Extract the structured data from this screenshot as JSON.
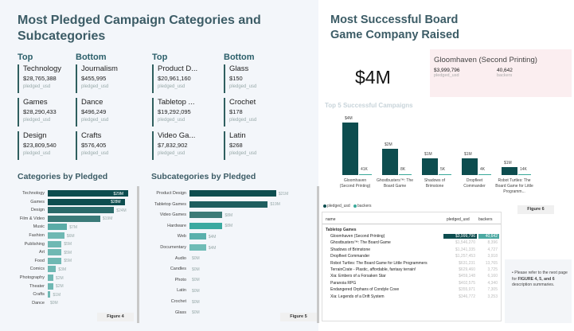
{
  "left_title": "Most Pledged Campaign Categories and Subcategories",
  "right_title": "Most Successful Board Game Company Raised",
  "categories_top": {
    "head": "Top",
    "items": [
      {
        "name": "Technology",
        "value": "$28,765,388",
        "label": "pledged_usd"
      },
      {
        "name": "Games",
        "value": "$28,290,433",
        "label": "pledged_usd"
      },
      {
        "name": "Design",
        "value": "$23,809,540",
        "label": "pledged_usd"
      }
    ]
  },
  "categories_bottom": {
    "head": "Bottom",
    "items": [
      {
        "name": "Journalism",
        "value": "$455,995",
        "label": "pledged_usd"
      },
      {
        "name": "Dance",
        "value": "$496,249",
        "label": "pledged_usd"
      },
      {
        "name": "Crafts",
        "value": "$576,405",
        "label": "pledged_usd"
      }
    ]
  },
  "subcategories_top": {
    "head": "Top",
    "items": [
      {
        "name": "Product D...",
        "value": "$20,961,160",
        "label": "pledged_usd"
      },
      {
        "name": "Tabletop ...",
        "value": "$19,292,095",
        "label": "pledged_usd"
      },
      {
        "name": "Video Ga...",
        "value": "$7,832,902",
        "label": "pledged_usd"
      }
    ]
  },
  "subcategories_bottom": {
    "head": "Bottom",
    "items": [
      {
        "name": "Glass",
        "value": "$150",
        "label": "pledged_usd"
      },
      {
        "name": "Crochet",
        "value": "$178",
        "label": "pledged_usd"
      },
      {
        "name": "Latin",
        "value": "$268",
        "label": "pledged_usd"
      }
    ]
  },
  "cat_chart": {
    "title": "Categories by Pledged",
    "figure": "Figure 4",
    "max": 30,
    "bars": [
      {
        "label": "Technology",
        "value": 29,
        "text": "$29M",
        "color": "#0d4d4f",
        "inside": true
      },
      {
        "label": "Games",
        "value": 28,
        "text": "$28M",
        "color": "#0d4d4f",
        "inside": true
      },
      {
        "label": "Design",
        "value": 24,
        "text": "$24M",
        "color": "#2a6a6a",
        "inside": false
      },
      {
        "label": "Film & Video",
        "value": 19,
        "text": "$19M",
        "color": "#3b7b79",
        "inside": false
      },
      {
        "label": "Music",
        "value": 7,
        "text": "$7M",
        "color": "#5aaba7",
        "inside": false
      },
      {
        "label": "Fashion",
        "value": 6,
        "text": "$6M",
        "color": "#6fb8b3",
        "inside": false
      },
      {
        "label": "Publishing",
        "value": 5,
        "text": "$5M",
        "color": "#6fb8b3",
        "inside": false
      },
      {
        "label": "Art",
        "value": 5,
        "text": "$5M",
        "color": "#6fb8b3",
        "inside": false
      },
      {
        "label": "Food",
        "value": 5,
        "text": "$5M",
        "color": "#6fb8b3",
        "inside": false
      },
      {
        "label": "Comics",
        "value": 3,
        "text": "$3M",
        "color": "#6fb8b3",
        "inside": false
      },
      {
        "label": "Photography",
        "value": 2,
        "text": "$2M",
        "color": "#6fb8b3",
        "inside": false
      },
      {
        "label": "Theater",
        "value": 2,
        "text": "$2M",
        "color": "#6fb8b3",
        "inside": false
      },
      {
        "label": "Crafts",
        "value": 1,
        "text": "$1M",
        "color": "#6fb8b3",
        "inside": false
      },
      {
        "label": "Dance",
        "value": 0,
        "text": "$0M",
        "color": "#6fb8b3",
        "inside": false
      }
    ]
  },
  "sub_chart": {
    "title": "Subcategories by Pledged",
    "figure": "Figure 5",
    "max": 22,
    "bars": [
      {
        "label": "Product Design",
        "value": 21,
        "text": "$21M",
        "color": "#0d4d4f"
      },
      {
        "label": "Tabletop Games",
        "value": 19,
        "text": "$19M",
        "color": "#1f5f5f"
      },
      {
        "label": "Video Games",
        "value": 8,
        "text": "$8M",
        "color": "#3d7b77"
      },
      {
        "label": "Hardware",
        "value": 8,
        "text": "$8M",
        "color": "#3aa9a0"
      },
      {
        "label": "Web",
        "value": 4,
        "text": "$4M",
        "color": "#5ab0ac"
      },
      {
        "label": "Documentary",
        "value": 4,
        "text": "$4M",
        "color": "#6fbcb6"
      },
      {
        "label": "Audio",
        "value": 0,
        "text": "$0M",
        "color": "#6fbcb6"
      },
      {
        "label": "Candles",
        "value": 0,
        "text": "$0M",
        "color": "#6fbcb6"
      },
      {
        "label": "Photo",
        "value": 0,
        "text": "$0M",
        "color": "#6fbcb6"
      },
      {
        "label": "Latin",
        "value": 0,
        "text": "$0M",
        "color": "#6fbcb6"
      },
      {
        "label": "Crochet",
        "value": 0,
        "text": "$0M",
        "color": "#6fbcb6"
      },
      {
        "label": "Glass",
        "value": 0,
        "text": "$0M",
        "color": "#6fbcb6"
      }
    ]
  },
  "big_number": "$4M",
  "card": {
    "title": "Gloomhaven (Second Printing)",
    "pledged_value": "$3,999,796",
    "pledged_label": "pledged_usd",
    "backers_value": "40,642",
    "backers_label": "backers"
  },
  "top5": {
    "title": "Top 5 Successful Campaigns",
    "figure": "Figure 6",
    "max": 4,
    "campaigns": [
      {
        "name": "Gloomhaven (Second Printing)",
        "pledged": 4,
        "pledged_text": "$4M",
        "backers_text": "41K"
      },
      {
        "name": "Ghostbusters™: The Board Game",
        "pledged": 2,
        "pledged_text": "$2M",
        "backers_text": "8K"
      },
      {
        "name": "Shadows of Brimstone",
        "pledged": 1.3,
        "pledged_text": "$1M",
        "backers_text": "5K"
      },
      {
        "name": "Dropfleet Commander",
        "pledged": 1.25,
        "pledged_text": "$1M",
        "backers_text": "4K"
      },
      {
        "name": "Robot Turtles: The Board Game for Little Programm...",
        "pledged": 0.63,
        "pledged_text": "$1M",
        "backers_text": "14K"
      }
    ],
    "legend": [
      "pledged_usd",
      "backers"
    ],
    "colors": {
      "pledged": "#0d4d4f",
      "backers": "#3aa99a"
    }
  },
  "table": {
    "headers": {
      "name": "name",
      "pledged": "pledged_usd",
      "backers": "backers"
    },
    "group": "Tabletop Games",
    "rows": [
      {
        "name": "Gloomhaven (Second Printing)",
        "pledged": "$3,999,796",
        "backers": "40,642",
        "selected": true
      },
      {
        "name": "Ghostbusters™: The Board Game",
        "pledged": "$1,546,270",
        "backers": "8,396"
      },
      {
        "name": "Shadows of Brimstone",
        "pledged": "$1,341,335",
        "backers": "4,727"
      },
      {
        "name": "Dropfleet Commander",
        "pledged": "$1,257,453",
        "backers": "3,918"
      },
      {
        "name": "Robot Turtles: The Board Game for Little Programmers",
        "pledged": "$631,231",
        "backers": "13,765"
      },
      {
        "name": "TerrainCrate - Plastic, affordable, fantasy terrain!",
        "pledged": "$629,460",
        "backers": "3,725"
      },
      {
        "name": "Xia: Embers of a Forsaken Star",
        "pledged": "$459,148",
        "backers": "6,160"
      },
      {
        "name": "Paranoia RPG",
        "pledged": "$402,575",
        "backers": "4,340"
      },
      {
        "name": "Endangered Orphans of Condyle Cove",
        "pledged": "$355,971",
        "backers": "7,305"
      },
      {
        "name": "Xia: Legends of a Drift System",
        "pledged": "$346,772",
        "backers": "3,253"
      }
    ]
  },
  "note": {
    "prefix": "Please refer to the next page for ",
    "bold": "FIGURE 4, 5, and 6",
    "suffix": " description summaries."
  }
}
